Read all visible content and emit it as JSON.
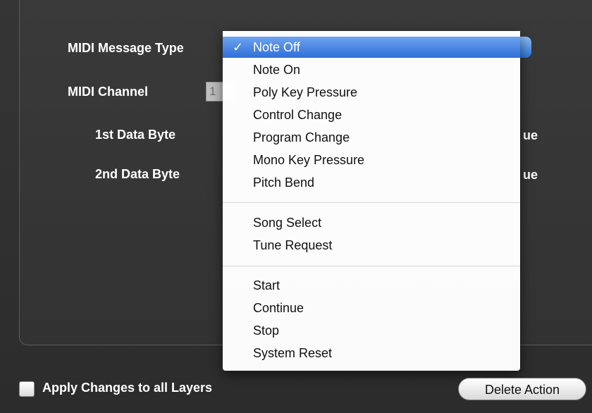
{
  "form": {
    "message_type_label": "MIDI Message Type",
    "channel_label": "MIDI Channel",
    "channel_value": "1",
    "byte1_label": "1st Data Byte",
    "byte2_label": "2nd Data Byte",
    "follows_suffix": "ue"
  },
  "menu": {
    "check_glyph": "✓",
    "items": [
      "Note Off",
      "Note On",
      "Poly Key Pressure",
      "Control Change",
      "Program Change",
      "Mono Key Pressure",
      "Pitch Bend",
      "Song Select",
      "Tune Request",
      "Start",
      "Continue",
      "Stop",
      "System Reset"
    ],
    "selected": "Note Off"
  },
  "footer": {
    "apply_all_label": "Apply Changes to all Layers",
    "delete_label": "Delete Action"
  },
  "colors": {
    "selection": "#3b7ce0",
    "background": "#333333"
  }
}
